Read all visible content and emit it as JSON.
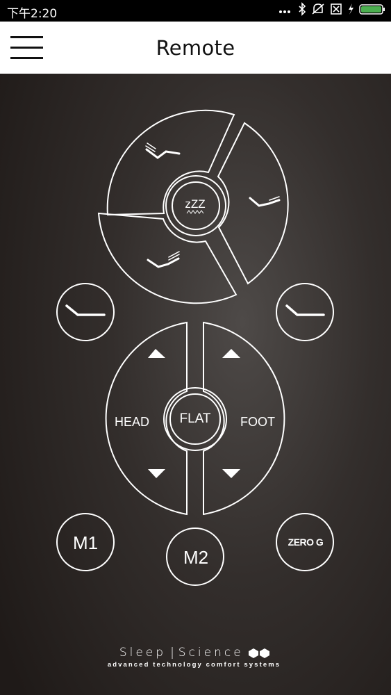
{
  "status": {
    "time": "下午2:20"
  },
  "header": {
    "title": "Remote"
  },
  "remote": {
    "sleep_label": "zZZ",
    "flat_label": "FLAT",
    "head_label": "HEAD",
    "foot_label": "FOOT",
    "m1_label": "M1",
    "m2_label": "M2",
    "zerog_label": "ZERO G"
  },
  "brand": {
    "name_left": "Sleep",
    "name_right": "Science",
    "tagline": "advanced technology comfort systems"
  },
  "colors": {
    "background": "#3a3432",
    "line": "#ffffff",
    "battery": "#4caf50"
  }
}
